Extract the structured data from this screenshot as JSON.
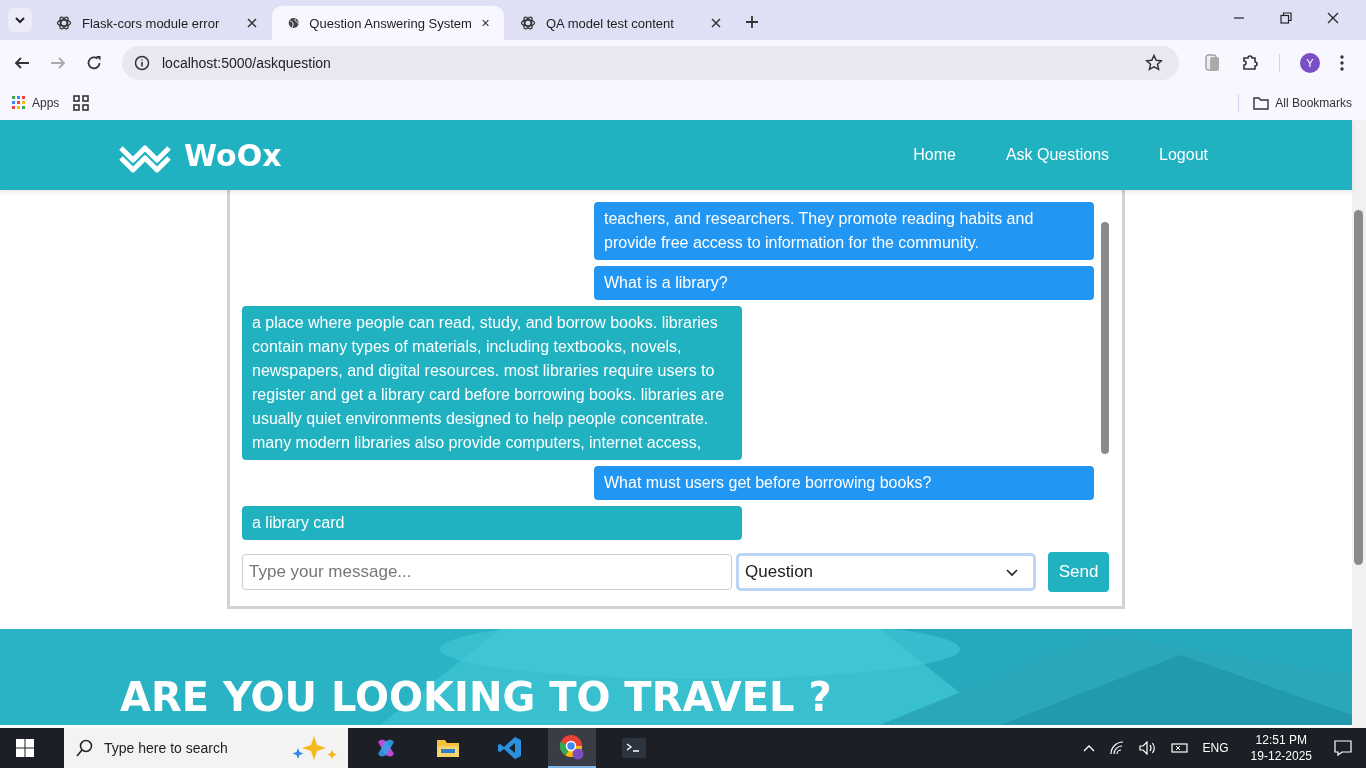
{
  "browser": {
    "tabs": [
      {
        "title": "Flask-cors module error",
        "selected": false,
        "kind": "knot"
      },
      {
        "title": "Question Answering System",
        "selected": true,
        "kind": "globe"
      },
      {
        "title": "QA model test content",
        "selected": false,
        "kind": "knot"
      }
    ],
    "address": "localhost:5000/askquestion",
    "bookmarks": [
      "Apps"
    ],
    "all_bookmarks": "All Bookmarks",
    "profile": "Y"
  },
  "site": {
    "brand": "WoOx",
    "nav": [
      "Home",
      "Ask Questions",
      "Logout"
    ]
  },
  "chat": {
    "messages": [
      {
        "kind": "user",
        "text": "teachers, and researchers. They promote reading habits and provide free access to information for the community."
      },
      {
        "kind": "user",
        "text": "What is a library?"
      },
      {
        "kind": "bot",
        "text": "a place where people can read, study, and borrow books. libraries contain many types of materials, including textbooks, novels, newspapers, and digital resources. most libraries require users to register and get a library card before borrowing books. libraries are usually quiet environments designed to help people concentrate. many modern libraries also provide computers, internet access,"
      },
      {
        "kind": "user",
        "text": "What must users get before borrowing books?"
      },
      {
        "kind": "bot",
        "text": "a library card"
      }
    ],
    "composer": {
      "placeholder": "Type your message...",
      "mode": "Question",
      "send": "Send"
    }
  },
  "banner": {
    "heading": "ARE YOU LOOKING TO TRAVEL ?"
  },
  "taskbar": {
    "search_placeholder": "Type here to search",
    "language": "ENG",
    "time": "12:51 PM",
    "date": "19-12-2025"
  }
}
